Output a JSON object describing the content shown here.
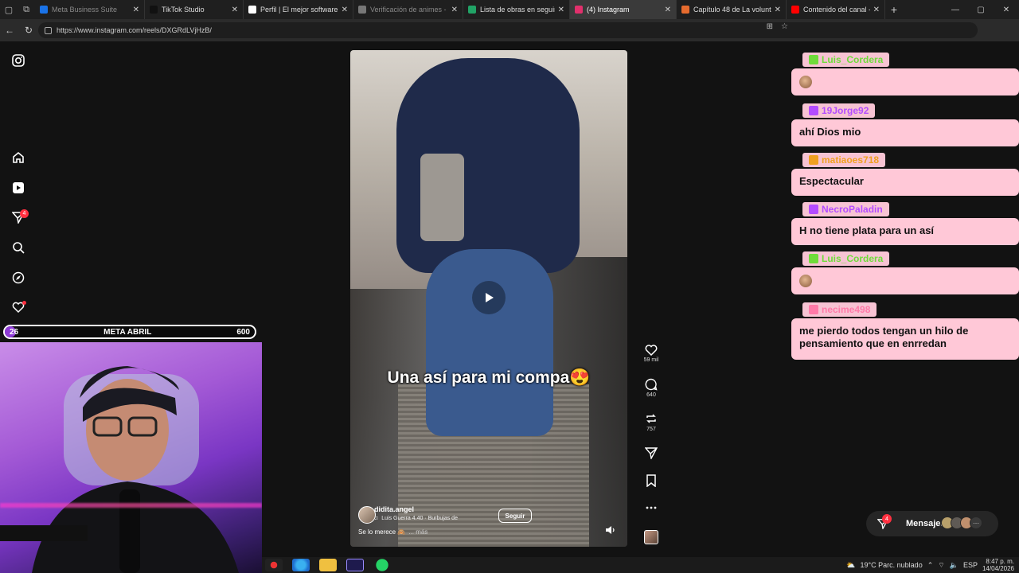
{
  "browser": {
    "tabs": [
      {
        "label": "Meta Business Suite",
        "color": "#1a73e8",
        "active": false,
        "dim": true
      },
      {
        "label": "TikTok Studio",
        "color": "#111111",
        "active": false,
        "dim": false
      },
      {
        "label": "Perfil | El mejor software pa",
        "color": "#ffffff",
        "active": false,
        "dim": false
      },
      {
        "label": "Verificación de animes - Ve",
        "color": "#777777",
        "active": false,
        "dim": true
      },
      {
        "label": "Lista de obras en seguimien",
        "color": "#21a366",
        "active": false,
        "dim": false
      },
      {
        "label": "(4) Instagram",
        "color": "#e1306c",
        "active": true,
        "dim": false
      },
      {
        "label": "Capítulo 48 de La voluntad",
        "color": "#e66b2e",
        "active": false,
        "dim": false
      },
      {
        "label": "Contenido del canal - YouTu",
        "color": "#ff0000",
        "active": false,
        "dim": false
      }
    ],
    "url": "https://www.instagram.com/reels/DXGRdLVjHzB/"
  },
  "instagram": {
    "notification_count": "4"
  },
  "goal": {
    "current": "26",
    "label": "META ABRIL",
    "target": "600",
    "progress_fraction": 0.043
  },
  "reel": {
    "caption": "Una así para mi compa😍",
    "author": "didita.angel",
    "audio": "Luis Guerra 4.40 · Burbujas de",
    "follow_label": "Seguir",
    "description": "Se lo merece 🙈",
    "more_label": "... más",
    "likes": "59 mil",
    "comments": "640",
    "reposts": "757"
  },
  "chat": [
    {
      "user": "Luis_Cordera",
      "name_color": "#6fdc3a",
      "text": ""
    },
    {
      "user": "19Jorge92",
      "name_color": "#b44cff",
      "text": "ahí Dios mio"
    },
    {
      "user": "matiaoes718",
      "name_color": "#f0a020",
      "text": "Espectacular"
    },
    {
      "user": "NecroPaladin",
      "name_color": "#b44cff",
      "text": "H no tiene plata para un así"
    },
    {
      "user": "Luis_Cordera",
      "name_color": "#6fdc3a",
      "text": ""
    },
    {
      "user": "necime498",
      "name_color": "#ff7aa8",
      "text": "me pierdo todos tengan un hilo de pensamiento que en enrredan"
    }
  ],
  "messages_pill": {
    "label": "Mensajes",
    "badge": "4"
  },
  "taskbar": {
    "weather": "19°C  Parc. nublado",
    "lang": "ESP",
    "time": "8:47 p. m.",
    "date": "14/04/2026"
  }
}
